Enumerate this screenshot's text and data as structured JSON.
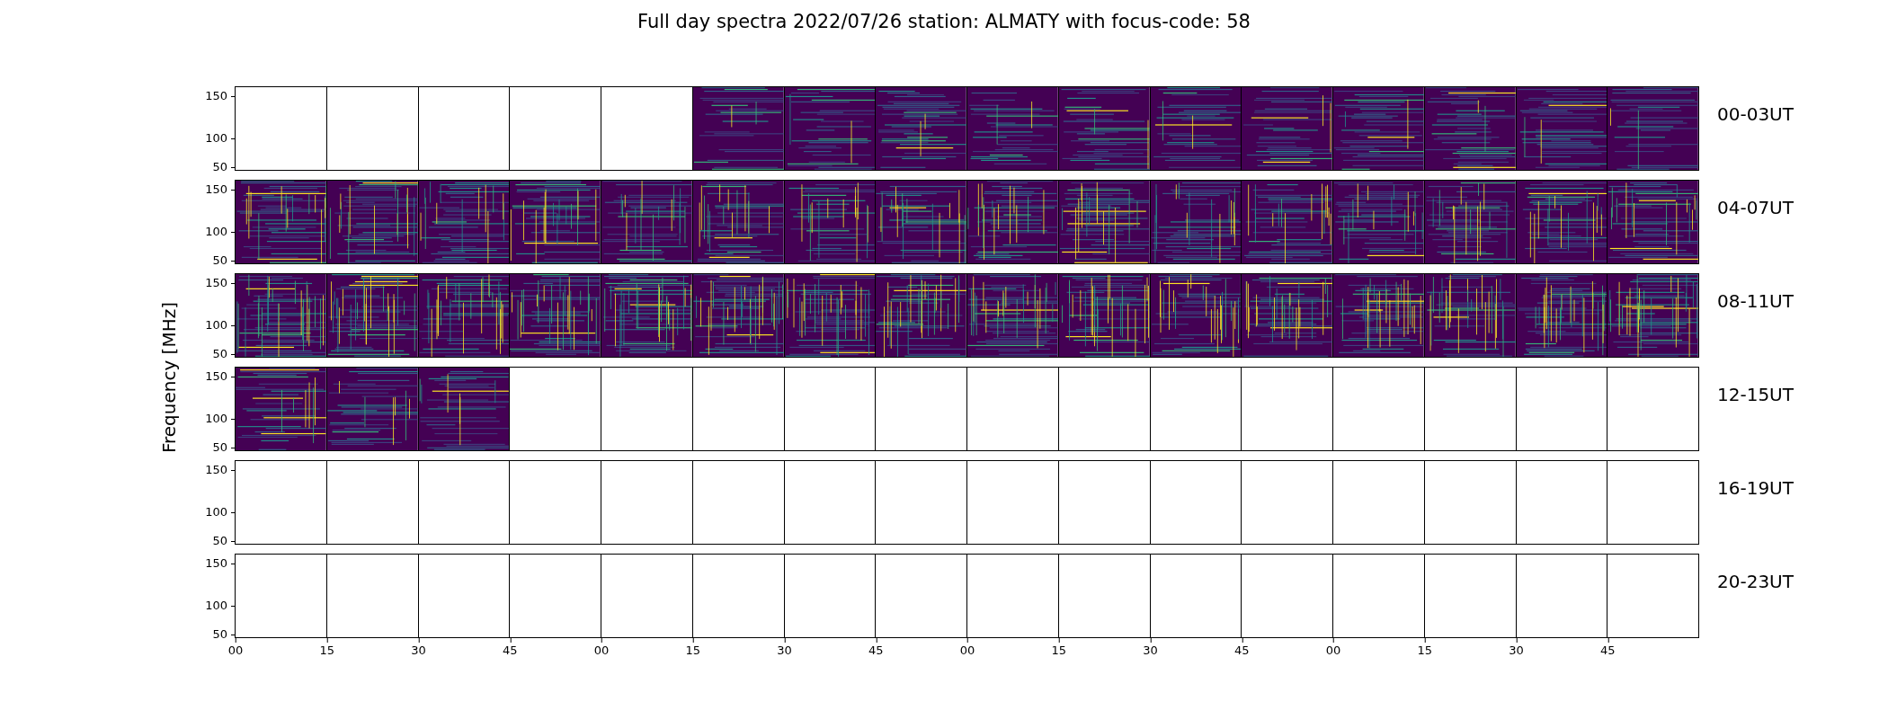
{
  "figure_title": "Full day spectra 2022/07/26 station: ALMATY with focus-code: 58",
  "y_axis_label": "Frequency [MHz]",
  "rows": [
    {
      "label": "00-03UT",
      "y_ticks": [
        "150",
        "100",
        "50"
      ],
      "panels": [
        {
          "filled": false
        },
        {
          "filled": false
        },
        {
          "filled": false
        },
        {
          "filled": false
        },
        {
          "filled": false
        },
        {
          "filled": true
        },
        {
          "filled": true
        },
        {
          "filled": true
        },
        {
          "filled": true
        },
        {
          "filled": true
        },
        {
          "filled": true
        },
        {
          "filled": true
        },
        {
          "filled": true
        },
        {
          "filled": true
        },
        {
          "filled": true
        },
        {
          "filled": true
        }
      ]
    },
    {
      "label": "04-07UT",
      "y_ticks": [
        "150",
        "100",
        "50"
      ],
      "panels": [
        {
          "filled": true
        },
        {
          "filled": true
        },
        {
          "filled": true
        },
        {
          "filled": true
        },
        {
          "filled": true
        },
        {
          "filled": true
        },
        {
          "filled": true
        },
        {
          "filled": true
        },
        {
          "filled": true
        },
        {
          "filled": true
        },
        {
          "filled": true
        },
        {
          "filled": true
        },
        {
          "filled": true
        },
        {
          "filled": true
        },
        {
          "filled": true
        },
        {
          "filled": true
        }
      ]
    },
    {
      "label": "08-11UT",
      "y_ticks": [
        "150",
        "100",
        "50"
      ],
      "panels": [
        {
          "filled": true
        },
        {
          "filled": true
        },
        {
          "filled": true
        },
        {
          "filled": true
        },
        {
          "filled": true
        },
        {
          "filled": true
        },
        {
          "filled": true
        },
        {
          "filled": true
        },
        {
          "filled": true
        },
        {
          "filled": true
        },
        {
          "filled": true
        },
        {
          "filled": true
        },
        {
          "filled": true
        },
        {
          "filled": true
        },
        {
          "filled": true
        },
        {
          "filled": true
        }
      ]
    },
    {
      "label": "12-15UT",
      "y_ticks": [
        "150",
        "100",
        "50"
      ],
      "panels": [
        {
          "filled": true
        },
        {
          "filled": true
        },
        {
          "filled": true
        },
        {
          "filled": false
        },
        {
          "filled": false
        },
        {
          "filled": false
        },
        {
          "filled": false
        },
        {
          "filled": false
        },
        {
          "filled": false
        },
        {
          "filled": false
        },
        {
          "filled": false
        },
        {
          "filled": false
        },
        {
          "filled": false
        },
        {
          "filled": false
        },
        {
          "filled": false
        },
        {
          "filled": false
        }
      ]
    },
    {
      "label": "16-19UT",
      "y_ticks": [
        "150",
        "100",
        "50"
      ],
      "panels": [
        {
          "filled": false
        },
        {
          "filled": false
        },
        {
          "filled": false
        },
        {
          "filled": false
        },
        {
          "filled": false
        },
        {
          "filled": false
        },
        {
          "filled": false
        },
        {
          "filled": false
        },
        {
          "filled": false
        },
        {
          "filled": false
        },
        {
          "filled": false
        },
        {
          "filled": false
        },
        {
          "filled": false
        },
        {
          "filled": false
        },
        {
          "filled": false
        },
        {
          "filled": false
        }
      ]
    },
    {
      "label": "20-23UT",
      "y_ticks": [
        "150",
        "100",
        "50"
      ],
      "panels": [
        {
          "filled": false
        },
        {
          "filled": false
        },
        {
          "filled": false
        },
        {
          "filled": false
        },
        {
          "filled": false
        },
        {
          "filled": false
        },
        {
          "filled": false
        },
        {
          "filled": false
        },
        {
          "filled": false
        },
        {
          "filled": false
        },
        {
          "filled": false
        },
        {
          "filled": false
        },
        {
          "filled": false
        },
        {
          "filled": false
        },
        {
          "filled": false
        },
        {
          "filled": false
        }
      ]
    }
  ],
  "x_ticks": [
    "00",
    "15",
    "30",
    "45",
    "00",
    "15",
    "30",
    "45",
    "00",
    "15",
    "30",
    "45",
    "00",
    "15",
    "30",
    "45"
  ]
}
